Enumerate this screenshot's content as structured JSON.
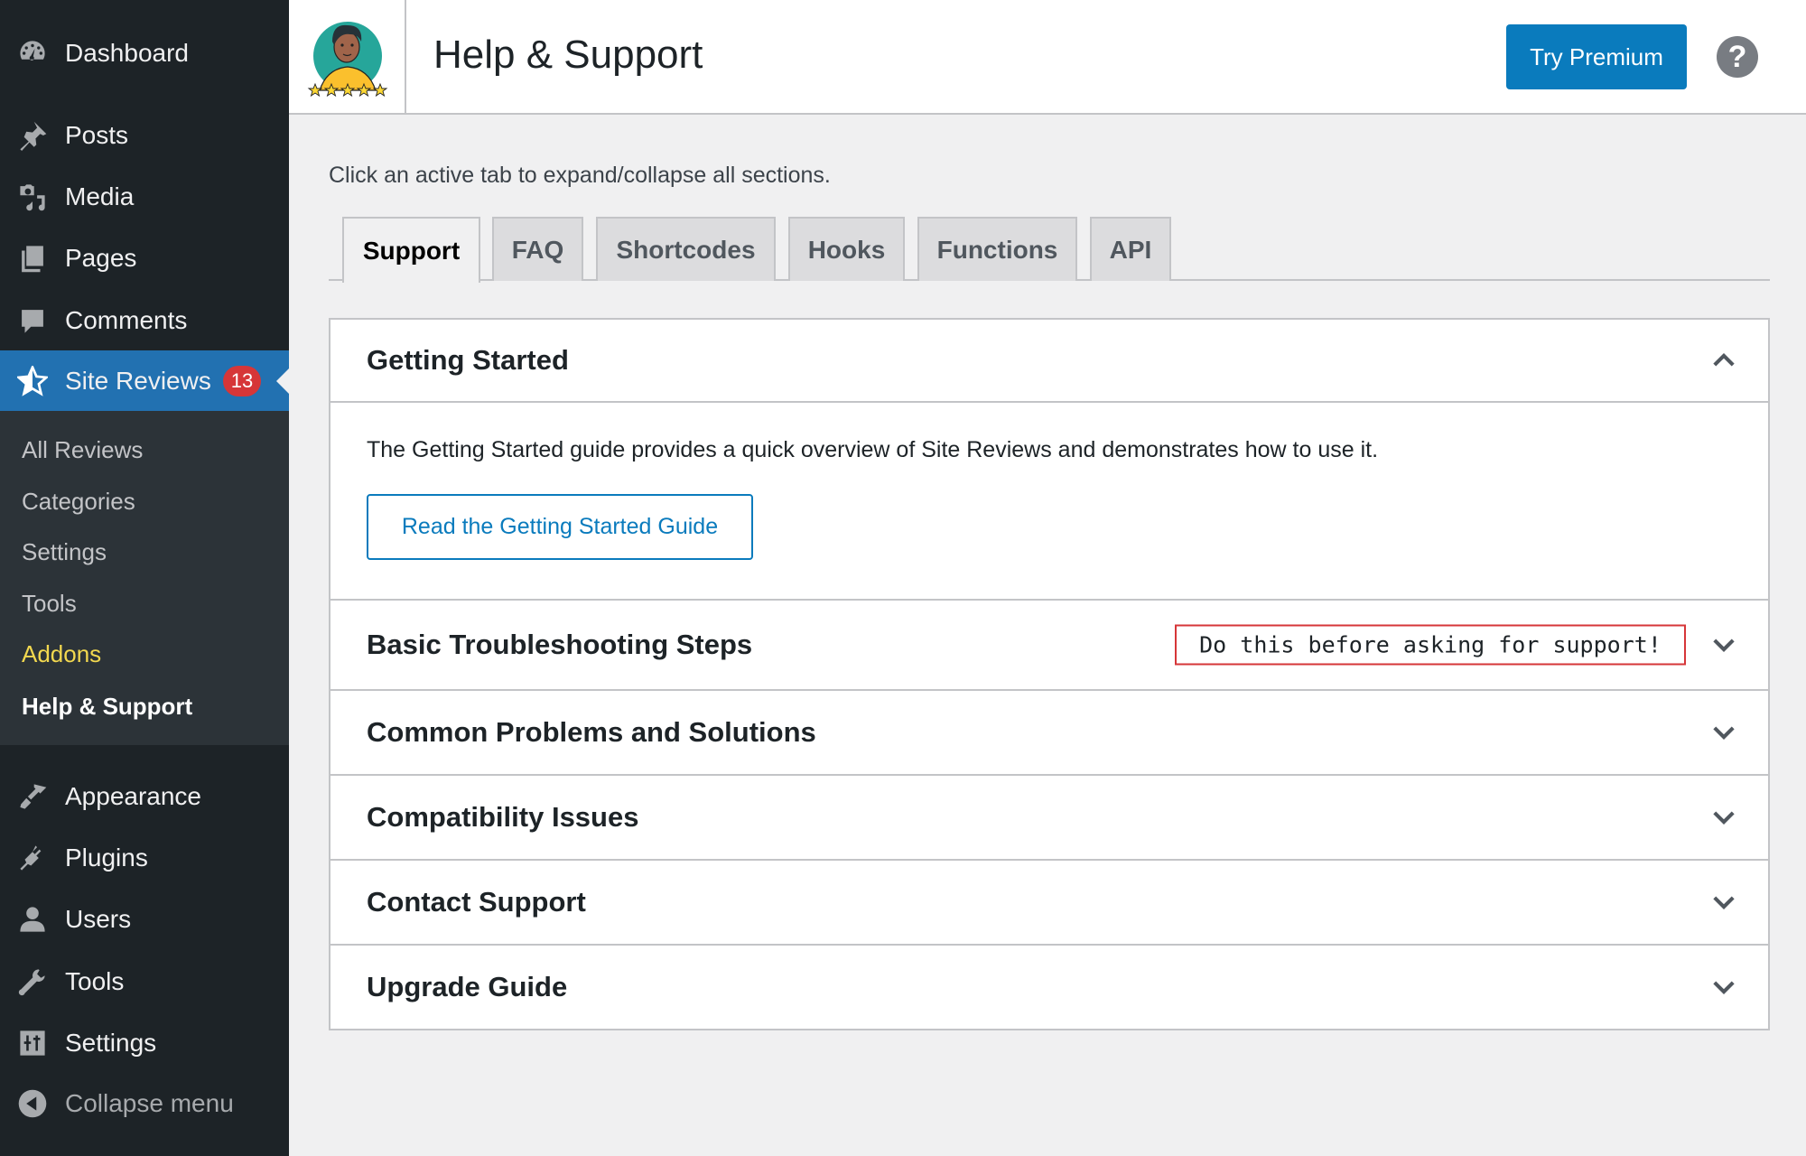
{
  "sidebar": {
    "items": [
      {
        "label": "Dashboard",
        "icon": "dashboard-icon"
      },
      {
        "label": "Posts",
        "icon": "pin-icon"
      },
      {
        "label": "Media",
        "icon": "media-icon"
      },
      {
        "label": "Pages",
        "icon": "pages-icon"
      },
      {
        "label": "Comments",
        "icon": "comment-icon"
      },
      {
        "label": "Site Reviews",
        "icon": "star-icon",
        "badge": "13",
        "active": true
      },
      {
        "label": "Appearance",
        "icon": "brush-icon"
      },
      {
        "label": "Plugins",
        "icon": "plug-icon"
      },
      {
        "label": "Users",
        "icon": "user-icon"
      },
      {
        "label": "Tools",
        "icon": "wrench-icon"
      },
      {
        "label": "Settings",
        "icon": "sliders-icon"
      }
    ],
    "submenu": [
      {
        "label": "All Reviews"
      },
      {
        "label": "Categories"
      },
      {
        "label": "Settings"
      },
      {
        "label": "Tools"
      },
      {
        "label": "Addons"
      },
      {
        "label": "Help & Support"
      }
    ],
    "collapse_label": "Collapse menu"
  },
  "header": {
    "title": "Help & Support",
    "premium_button": "Try Premium",
    "help_icon": "?"
  },
  "main": {
    "hint": "Click an active tab to expand/collapse all sections.",
    "tabs": [
      {
        "label": "Support",
        "active": true
      },
      {
        "label": "FAQ"
      },
      {
        "label": "Shortcodes"
      },
      {
        "label": "Hooks"
      },
      {
        "label": "Functions"
      },
      {
        "label": "API"
      }
    ],
    "sections": [
      {
        "title": "Getting Started",
        "expanded": true,
        "description": "The Getting Started guide provides a quick overview of Site Reviews and demonstrates how to use it.",
        "button": "Read the Getting Started Guide"
      },
      {
        "title": "Basic Troubleshooting Steps",
        "note": "Do this before asking for support!"
      },
      {
        "title": "Common Problems and Solutions"
      },
      {
        "title": "Compatibility Issues"
      },
      {
        "title": "Contact Support"
      },
      {
        "title": "Upgrade Guide"
      }
    ]
  },
  "colors": {
    "sidebar_bg": "#1d2327",
    "active_menu": "#2271b1",
    "badge": "#d63638",
    "primary_button": "#0a7bbd",
    "addons_highlight": "#f2d84f"
  }
}
